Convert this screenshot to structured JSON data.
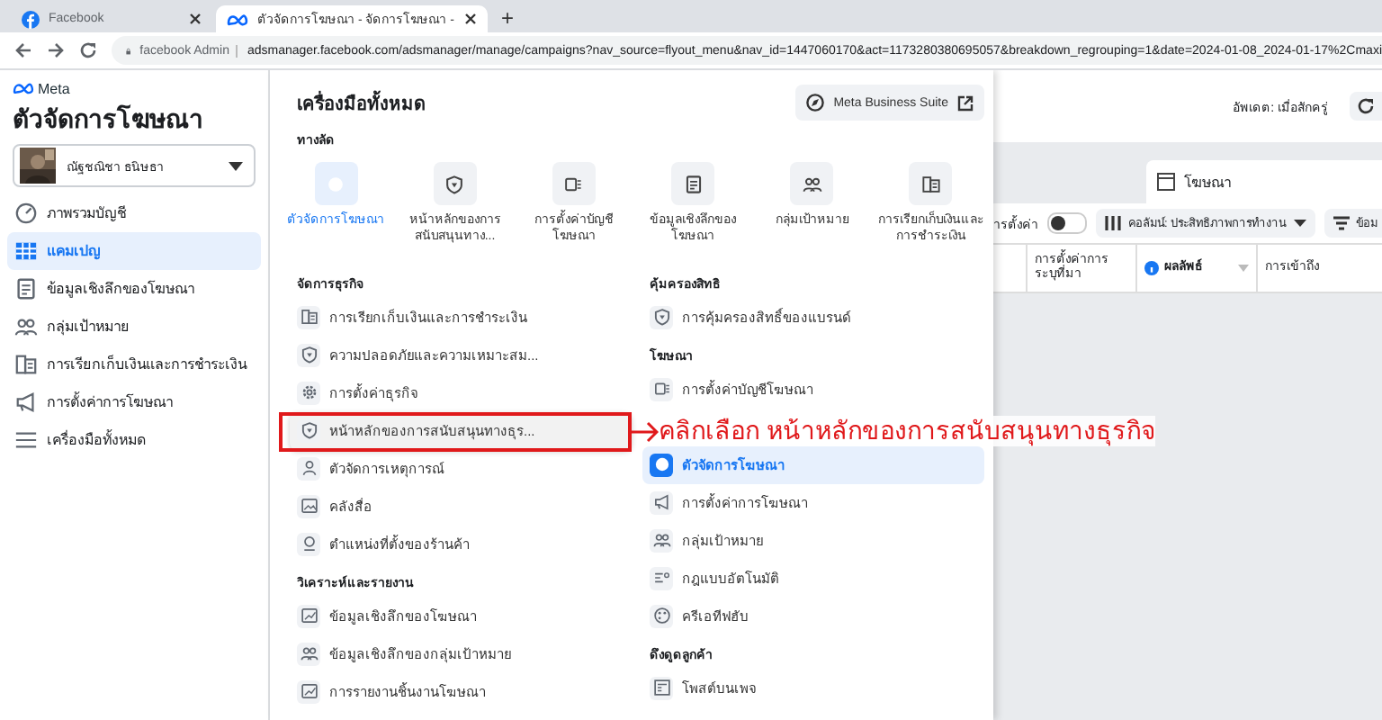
{
  "browser": {
    "tabs": [
      {
        "title": "Facebook",
        "selected": false
      },
      {
        "title": "ตัวจัดการโฆษณา - จัดการโฆษณา - ",
        "selected": true
      }
    ],
    "new_tab": "+",
    "site": "facebook Admin",
    "url": "adsmanager.facebook.com/adsmanager/manage/campaigns?nav_source=flyout_menu&nav_id=1447060170&act=1173280380695057&breakdown_regrouping=1&date=2024-01-08_2024-01-17%2Cmaxi"
  },
  "sidebar": {
    "brand": "Meta",
    "title": "ตัวจัดการโฆษณา",
    "account": "ณัฐชณิชา ธนิษธา",
    "items": [
      {
        "label": "ภาพรวมบัญชี",
        "selected": false
      },
      {
        "label": "แคมเปญ",
        "selected": true
      },
      {
        "label": "ข้อมูลเชิงลึกของโฆษณา",
        "selected": false
      },
      {
        "label": "กลุ่มเป้าหมาย",
        "selected": false
      },
      {
        "label": "การเรียกเก็บเงินและการชำระเงิน",
        "selected": false
      },
      {
        "label": "การตั้งค่าการโฆษณา",
        "selected": false
      },
      {
        "label": "เครื่องมือทั้งหมด",
        "selected": false
      }
    ]
  },
  "menu": {
    "title": "เครื่องมือทั้งหมด",
    "suite_button": "Meta Business Suite",
    "shortcuts_heading": "ทางลัด",
    "shortcuts": [
      {
        "label": "ตัวจัดการโฆษณา",
        "selected": true
      },
      {
        "label": "หน้าหลักของการสนับสนุนทาง...",
        "selected": false
      },
      {
        "label": "การตั้งค่าบัญชีโฆษณา",
        "selected": false
      },
      {
        "label": "ข้อมูลเชิงลึกของโฆษณา",
        "selected": false
      },
      {
        "label": "กลุ่มเป้าหมาย",
        "selected": false
      },
      {
        "label": "การเรียกเก็บเงินและการชำระเงิน",
        "selected": false
      }
    ],
    "columns": [
      [
        {
          "heading": "จัดการธุรกิจ",
          "items": [
            {
              "label": "การเรียกเก็บเงินและการชำระเงิน",
              "selected": false,
              "hovered": false
            },
            {
              "label": "ความปลอดภัยและความเหมาะสม...",
              "selected": false,
              "hovered": false
            },
            {
              "label": "การตั้งค่าธุรกิจ",
              "selected": false,
              "hovered": false
            },
            {
              "label": "หน้าหลักของการสนับสนุนทางธุร...",
              "selected": false,
              "hovered": true
            },
            {
              "label": "ตัวจัดการเหตุการณ์",
              "selected": false,
              "hovered": false
            },
            {
              "label": "คลังสื่อ",
              "selected": false,
              "hovered": false
            },
            {
              "label": "ตำแหน่งที่ตั้งของร้านค้า",
              "selected": false,
              "hovered": false
            }
          ]
        },
        {
          "heading": "วิเคราะห์และรายงาน",
          "items": [
            {
              "label": "ข้อมูลเชิงลึกของโฆษณา",
              "selected": false,
              "hovered": false
            },
            {
              "label": "ข้อมูลเชิงลึกของกลุ่มเป้าหมาย",
              "selected": false,
              "hovered": false
            },
            {
              "label": "การรายงานชิ้นงานโฆษณา",
              "selected": false,
              "hovered": false
            }
          ]
        }
      ],
      [
        {
          "heading": "คุ้มครองสิทธิ",
          "items": [
            {
              "label": "การคุ้มครองสิทธิ์ของแบรนด์",
              "selected": false,
              "hovered": false
            }
          ]
        },
        {
          "heading": "โฆษณา",
          "items": [
            {
              "label": "การตั้งค่าบัญชีโฆษณา",
              "selected": false,
              "hovered": false
            },
            {
              "label": "ตัวจัดการโฆษณา",
              "selected": true,
              "hovered": false
            },
            {
              "label": "การตั้งค่าการโฆษณา",
              "selected": false,
              "hovered": false
            },
            {
              "label": "กลุ่มเป้าหมาย",
              "selected": false,
              "hovered": false
            },
            {
              "label": "กฎแบบอัตโนมัติ",
              "selected": false,
              "hovered": false
            },
            {
              "label": "ครีเอทีฟฮับ",
              "selected": false,
              "hovered": false
            }
          ]
        },
        {
          "heading": "ดึงดูดลูกค้า",
          "items": [
            {
              "label": "โพสต์บนเพจ",
              "selected": false,
              "hovered": false
            }
          ]
        }
      ]
    ]
  },
  "background": {
    "updated": "อัพเดต: เมื่อสักครู่",
    "tab": "โฆษณา",
    "setting_label": "ารตั้งค่า",
    "toggle_on": false,
    "columns_button": "คอลัมน์: ประสิทธิภาพการทำงาน",
    "data_button": "ข้อม",
    "table_columns": [
      "การตั้งค่าการระบุที่มา",
      "ผลลัพธ์",
      "การเข้าถึง"
    ]
  },
  "annotation": {
    "text": "คลิกเลือก หน้าหลักของการสนับสนุนทางธุรกิจ"
  }
}
